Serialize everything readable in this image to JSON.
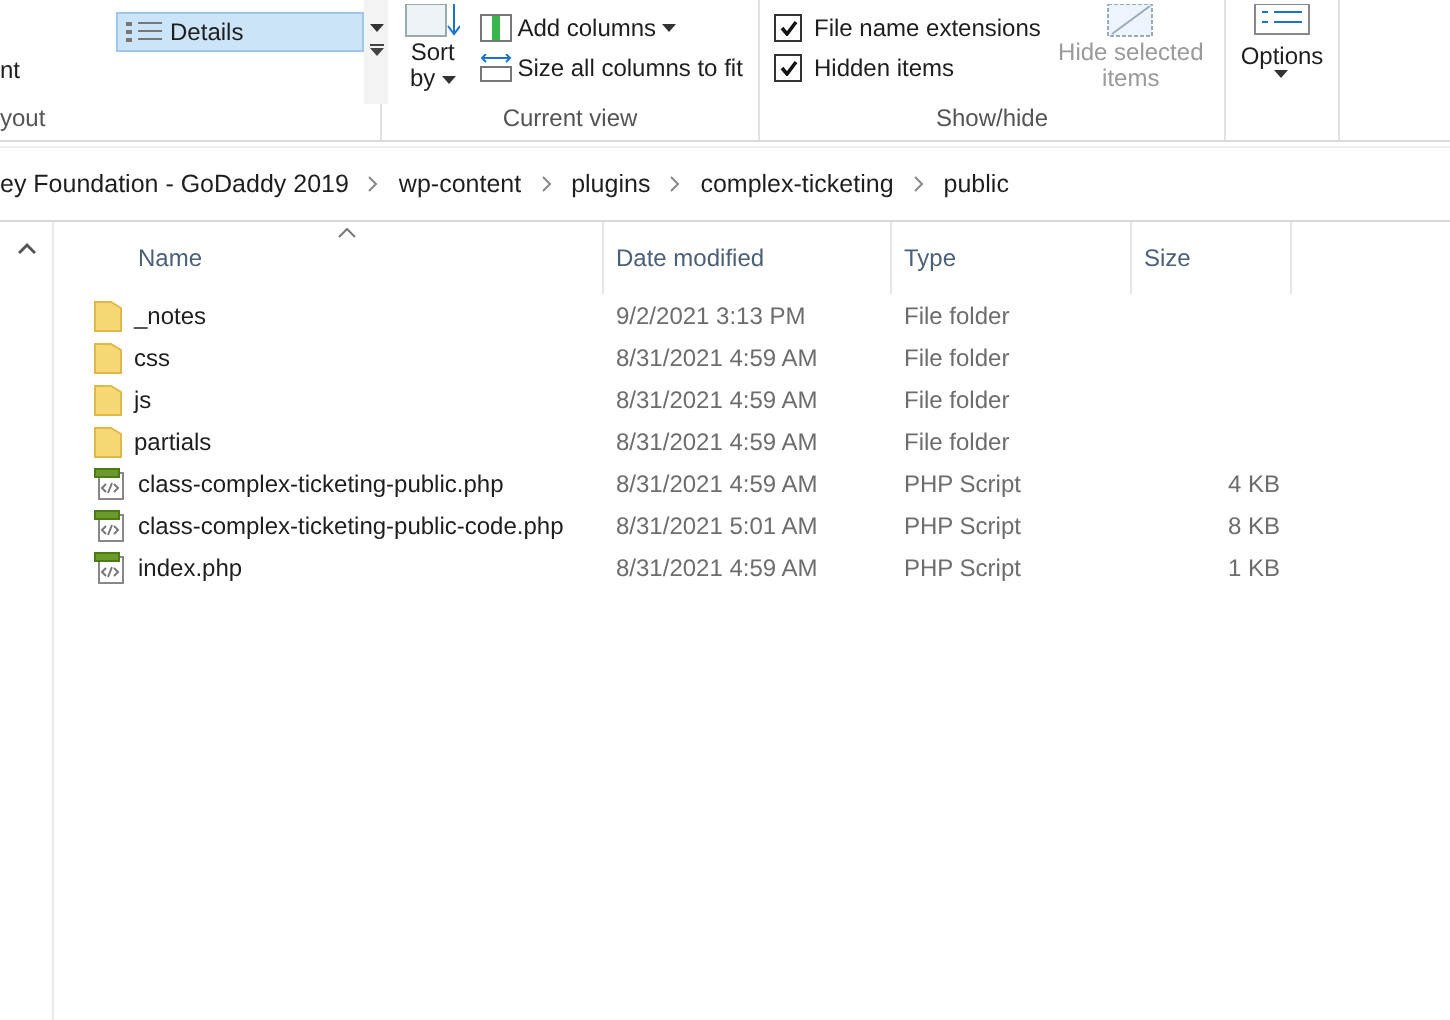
{
  "ribbon": {
    "layout": {
      "cut_label": "nt",
      "views": [
        {
          "label": "Details",
          "selected": true
        }
      ],
      "group_label": "yout"
    },
    "current_view": {
      "sort_by": [
        "Sort",
        "by"
      ],
      "buttons": [
        {
          "kind": "add",
          "label": "Add columns",
          "dropdown": true
        },
        {
          "kind": "fit",
          "label": "Size all columns to fit",
          "dropdown": false
        }
      ],
      "group_label": "Current view"
    },
    "show_hide": {
      "checkboxes": [
        {
          "label": "File name extensions",
          "checked": true
        },
        {
          "label": "Hidden items",
          "checked": true
        }
      ],
      "hide_selected": {
        "label": "Hide selected items",
        "disabled": true
      },
      "group_label": "Show/hide"
    },
    "options": {
      "label": "Options"
    }
  },
  "breadcrumbs": [
    "ey Foundation - GoDaddy  2019",
    "wp-content",
    "plugins",
    "complex-ticketing",
    "public"
  ],
  "table": {
    "columns": [
      "Name",
      "Date modified",
      "Type",
      "Size"
    ],
    "rows": [
      {
        "kind": "folder",
        "name": "_notes",
        "date": "9/2/2021 3:13 PM",
        "type": "File folder"
      },
      {
        "kind": "folder",
        "name": "css",
        "date": "8/31/2021 4:59 AM",
        "type": "File folder"
      },
      {
        "kind": "folder",
        "name": "js",
        "date": "8/31/2021 4:59 AM",
        "type": "File folder"
      },
      {
        "kind": "folder",
        "name": "partials",
        "date": "8/31/2021 4:59 AM",
        "type": "File folder"
      },
      {
        "kind": "php",
        "name": "class-complex-ticketing-public.php",
        "date": "8/31/2021 4:59 AM",
        "type": "PHP Script",
        "size": "4 KB"
      },
      {
        "kind": "php",
        "name": "class-complex-ticketing-public-code.php",
        "date": "8/31/2021 5:01 AM",
        "type": "PHP Script",
        "size": "8 KB"
      },
      {
        "kind": "php",
        "name": "index.php",
        "date": "8/31/2021 4:59 AM",
        "type": "PHP Script",
        "size": "1 KB"
      }
    ]
  }
}
